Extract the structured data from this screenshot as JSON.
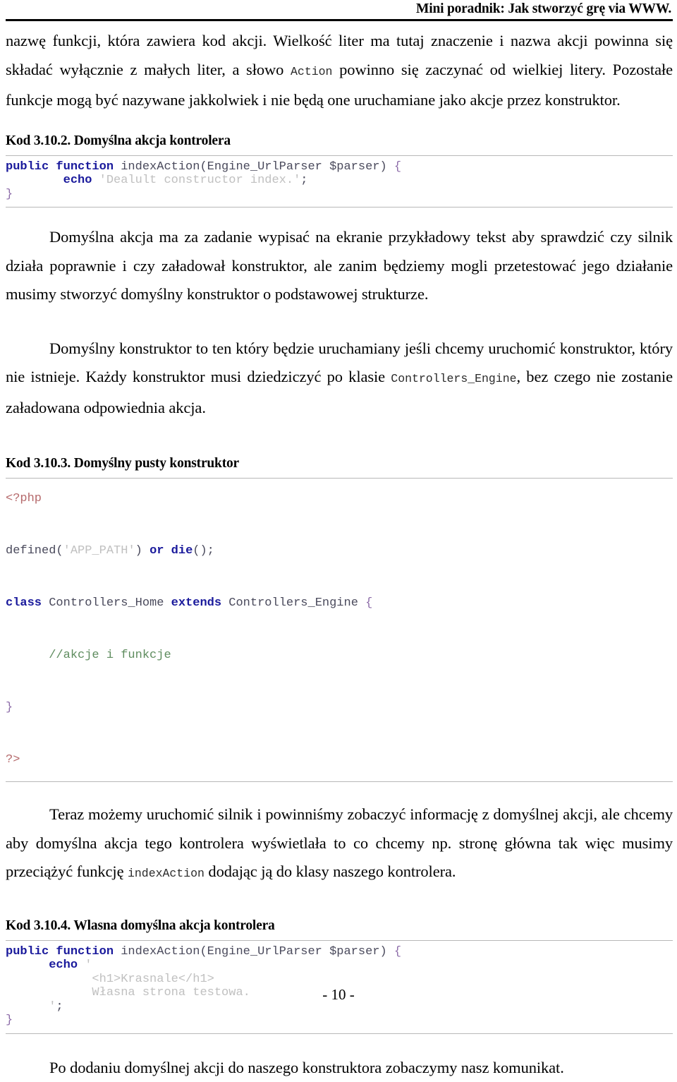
{
  "header": {
    "title": "Mini poradnik: Jak stworzyć grę via WWW."
  },
  "paragraphs": {
    "p1_a": "nazwę funkcji, która zawiera kod akcji. Wielkość liter ma tutaj znaczenie i nazwa akcji powinna się składać wyłącznie z małych liter, a słowo ",
    "p1_mono": "Action",
    "p1_b": " powinno się zaczynać od wielkiej litery. Pozostałe funkcje mogą być nazywane jakkolwiek i nie będą one uruchamiane jako akcje przez konstruktor.",
    "p2": "Domyślna akcja ma za zadanie wypisać na ekranie przykładowy tekst aby sprawdzić czy silnik działa poprawnie i czy załadował konstruktor, ale zanim będziemy mogli przetestować jego działanie musimy stworzyć domyślny konstruktor o podstawowej strukturze.",
    "p3_a": "Domyślny konstruktor to ten który będzie uruchamiany jeśli chcemy uruchomić konstruktor, który nie istnieje. Każdy konstruktor musi dziedziczyć po klasie ",
    "p3_mono": "Controllers_Engine",
    "p3_b": ", bez czego nie zostanie załadowana odpowiednia akcja.",
    "p4_a": "Teraz możemy uruchomić silnik i powinniśmy zobaczyć informację z domyślnej akcji, ale chcemy aby domyślna akcja tego kontrolera wyświetlała to co chcemy np. stronę główna tak więc musimy przeciążyć funkcję ",
    "p4_mono": "indexAction",
    "p4_b": " dodając ją do klasy naszego kontrolera.",
    "p5": "Po dodaniu domyślnej akcji do naszego konstruktora zobaczymy nasz komunikat."
  },
  "code_listings": [
    {
      "caption": "Kod 3.10.2. Domyślna akcja kontrolera",
      "lines": [
        [
          {
            "t": "public function",
            "c": "keyword"
          },
          {
            "t": " indexAction(Engine_UrlParser $parser) ",
            "c": "plain"
          },
          {
            "t": "{",
            "c": "punct"
          }
        ],
        [
          {
            "t": "        ",
            "c": "plain"
          },
          {
            "t": "echo",
            "c": "keyword"
          },
          {
            "t": " ",
            "c": "plain"
          },
          {
            "t": "'Dealult constructor index.'",
            "c": "string"
          },
          {
            "t": ";",
            "c": "plain"
          }
        ],
        [
          {
            "t": "}",
            "c": "punct"
          }
        ]
      ]
    },
    {
      "caption": "Kod 3.10.3. Domyślny pusty konstruktor",
      "lines": [
        [
          {
            "t": "<?php",
            "c": "tag"
          }
        ],
        [
          {
            "t": "",
            "c": "plain"
          }
        ],
        [
          {
            "t": "defined(",
            "c": "plain"
          },
          {
            "t": "'APP_PATH'",
            "c": "string"
          },
          {
            "t": ") ",
            "c": "plain"
          },
          {
            "t": "or die",
            "c": "keyword"
          },
          {
            "t": "();",
            "c": "plain"
          }
        ],
        [
          {
            "t": "",
            "c": "plain"
          }
        ],
        [
          {
            "t": "class",
            "c": "keyword"
          },
          {
            "t": " Controllers_Home ",
            "c": "plain"
          },
          {
            "t": "extends",
            "c": "keyword"
          },
          {
            "t": " Controllers_Engine ",
            "c": "plain"
          },
          {
            "t": "{",
            "c": "punct"
          }
        ],
        [
          {
            "t": "",
            "c": "plain"
          }
        ],
        [
          {
            "t": "      ",
            "c": "plain"
          },
          {
            "t": "//akcje i funkcje",
            "c": "comment"
          }
        ],
        [
          {
            "t": "",
            "c": "plain"
          }
        ],
        [
          {
            "t": "}",
            "c": "punct"
          }
        ],
        [
          {
            "t": "",
            "c": "plain"
          }
        ],
        [
          {
            "t": "?>",
            "c": "tag"
          }
        ]
      ]
    },
    {
      "caption": "Kod 3.10.4. Wlasna domyślna akcja kontrolera",
      "lines": [
        [
          {
            "t": "public function",
            "c": "keyword"
          },
          {
            "t": " indexAction(Engine_UrlParser $parser) ",
            "c": "plain"
          },
          {
            "t": "{",
            "c": "punct"
          }
        ],
        [
          {
            "t": "      ",
            "c": "plain"
          },
          {
            "t": "echo",
            "c": "keyword"
          },
          {
            "t": " ",
            "c": "plain"
          },
          {
            "t": "'",
            "c": "string"
          }
        ],
        [
          {
            "t": "            ",
            "c": "plain"
          },
          {
            "t": "<h1>Krasnale</h1>",
            "c": "string"
          }
        ],
        [
          {
            "t": "            ",
            "c": "plain"
          },
          {
            "t": "Własna strona testowa.",
            "c": "string"
          }
        ],
        [
          {
            "t": "      ",
            "c": "plain"
          },
          {
            "t": "'",
            "c": "string"
          },
          {
            "t": ";",
            "c": "plain"
          }
        ],
        [
          {
            "t": "}",
            "c": "punct"
          }
        ]
      ]
    }
  ],
  "footer": {
    "page_number": "- 10 -"
  },
  "colors": {
    "keyword": "#1a1a9c",
    "string": "#c0c0c0",
    "comment": "#5e8c5e",
    "tag": "#b5696b",
    "punct": "#8c6ba8",
    "plain": "#4a4a5c",
    "rule": "#b8b8b8",
    "header_rule": "#000000"
  }
}
